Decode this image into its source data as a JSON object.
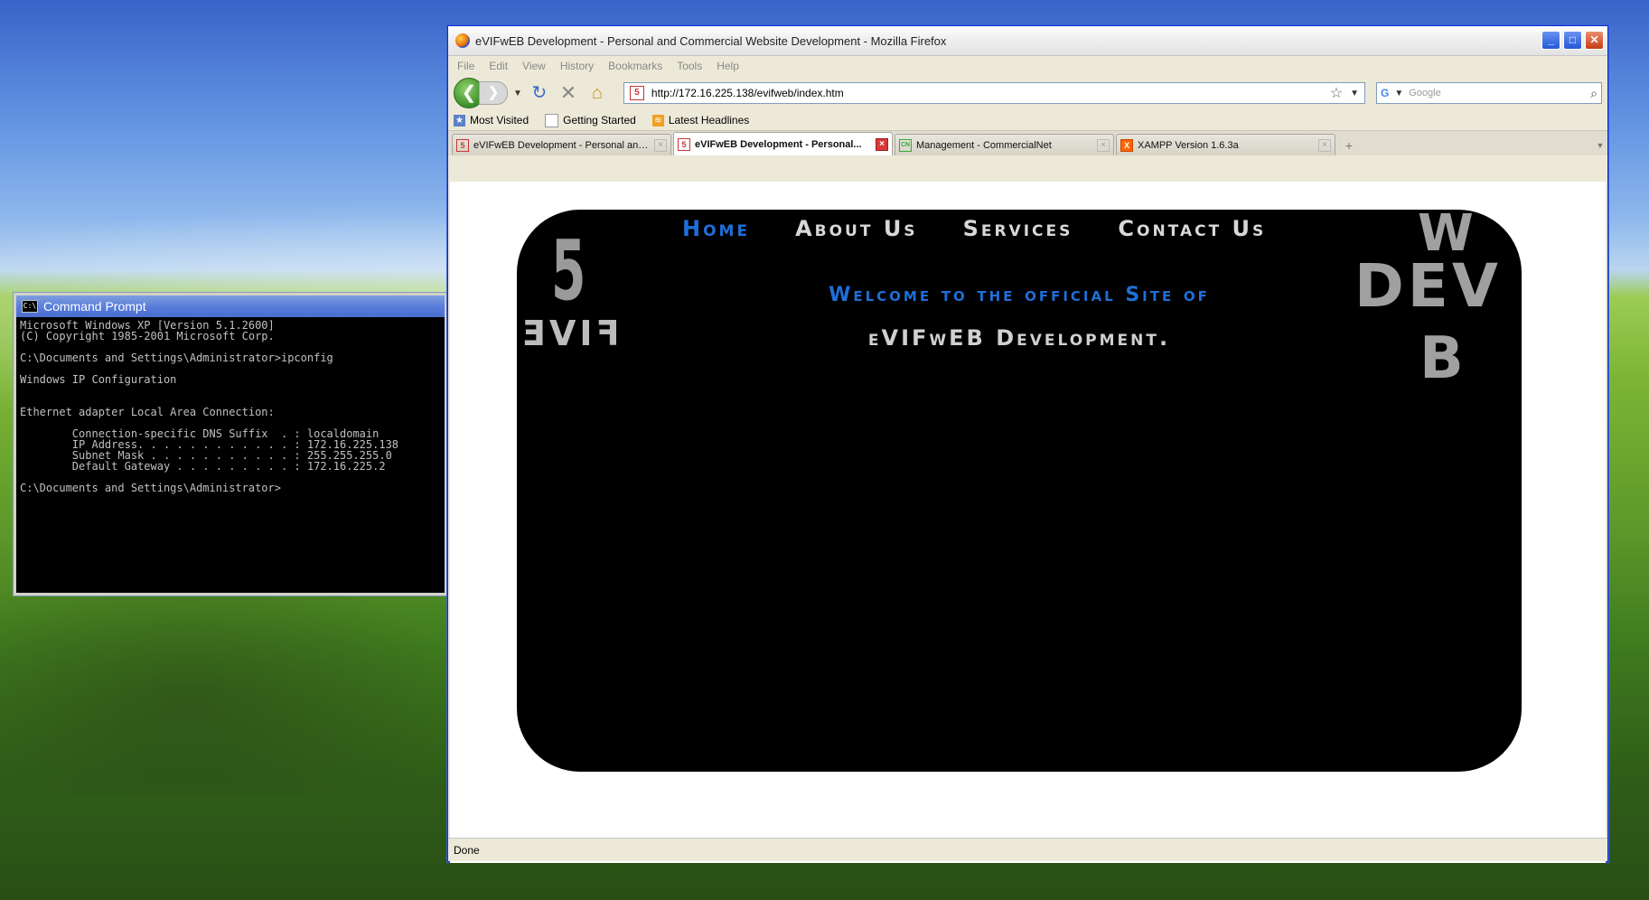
{
  "cmd": {
    "title": "Command Prompt",
    "icon": "C:\\",
    "output": "Microsoft Windows XP [Version 5.1.2600]\n(C) Copyright 1985-2001 Microsoft Corp.\n\nC:\\Documents and Settings\\Administrator>ipconfig\n\nWindows IP Configuration\n\n\nEthernet adapter Local Area Connection:\n\n        Connection-specific DNS Suffix  . : localdomain\n        IP Address. . . . . . . . . . . . : 172.16.225.138\n        Subnet Mask . . . . . . . . . . . : 255.255.255.0\n        Default Gateway . . . . . . . . . : 172.16.225.2\n\nC:\\Documents and Settings\\Administrator>"
  },
  "firefox": {
    "title": "eVIFwEB Development - Personal and Commercial Website Development - Mozilla Firefox",
    "menu": [
      "File",
      "Edit",
      "View",
      "History",
      "Bookmarks",
      "Tools",
      "Help"
    ],
    "url": "http://172.16.225.138/evifweb/index.htm",
    "search_placeholder": "Google",
    "bookmarks": [
      {
        "label": "Most Visited",
        "icon": "star-folder-icon"
      },
      {
        "label": "Getting Started",
        "icon": "page-icon"
      },
      {
        "label": "Latest Headlines",
        "icon": "rss-icon"
      }
    ],
    "tabs": [
      {
        "title": "eVIFwEB Development - Personal and ...",
        "favicon": "5",
        "active": false
      },
      {
        "title": "eVIFwEB Development - Personal...",
        "favicon": "5",
        "active": true
      },
      {
        "title": "Management - CommercialNet",
        "favicon": "CN",
        "active": false
      },
      {
        "title": "XAMPP Version 1.6.3a",
        "favicon": "X",
        "active": false
      }
    ],
    "status": "Done"
  },
  "page": {
    "nav": [
      "Home",
      "About Us",
      "Services",
      "Contact Us"
    ],
    "welcome": "Welcome to the official Site of",
    "company": "eVIFwEB Development.",
    "logo_number": "5",
    "logo_word": "FIVE",
    "logo_w": "W",
    "logo_dev": "DEV",
    "logo_b": "B",
    "accent_color": "#1e6fd9"
  }
}
